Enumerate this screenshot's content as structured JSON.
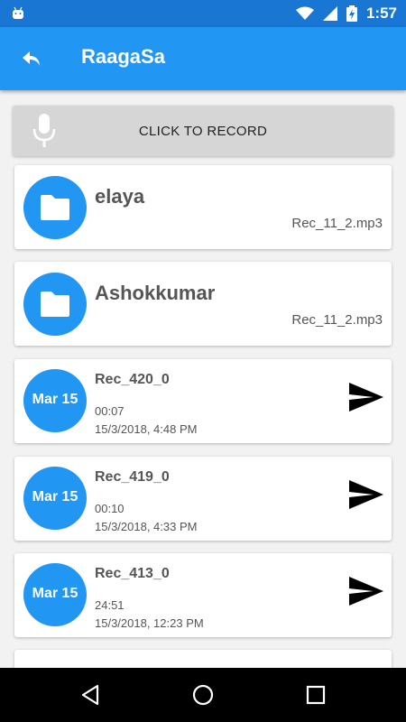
{
  "status_bar": {
    "time": "1:57"
  },
  "app_bar": {
    "title": "RaagaSa"
  },
  "record": {
    "label": "CLICK TO RECORD"
  },
  "folders": [
    {
      "name": "elaya",
      "file": "Rec_11_2.mp3"
    },
    {
      "name": "Ashokkumar",
      "file": "Rec_11_2.mp3"
    }
  ],
  "recordings": [
    {
      "badge": "Mar 15",
      "name": "Rec_420_0",
      "duration": "00:07",
      "datetime": "15/3/2018, 4:48 PM"
    },
    {
      "badge": "Mar 15",
      "name": "Rec_419_0",
      "duration": "00:10",
      "datetime": "15/3/2018, 4:33 PM"
    },
    {
      "badge": "Mar 15",
      "name": "Rec_413_0",
      "duration": "24:51",
      "datetime": "15/3/2018, 12:23 PM"
    }
  ],
  "colors": {
    "primary": "#2196f3",
    "primary_dark": "#1976d2",
    "record_button": "#d6d6d6"
  },
  "icons": [
    "android-icon",
    "wifi-icon",
    "signal-icon",
    "battery-charging-icon",
    "back-arrow-icon",
    "microphone-icon",
    "folder-icon",
    "send-icon",
    "nav-back-icon",
    "nav-home-icon",
    "nav-recents-icon"
  ]
}
